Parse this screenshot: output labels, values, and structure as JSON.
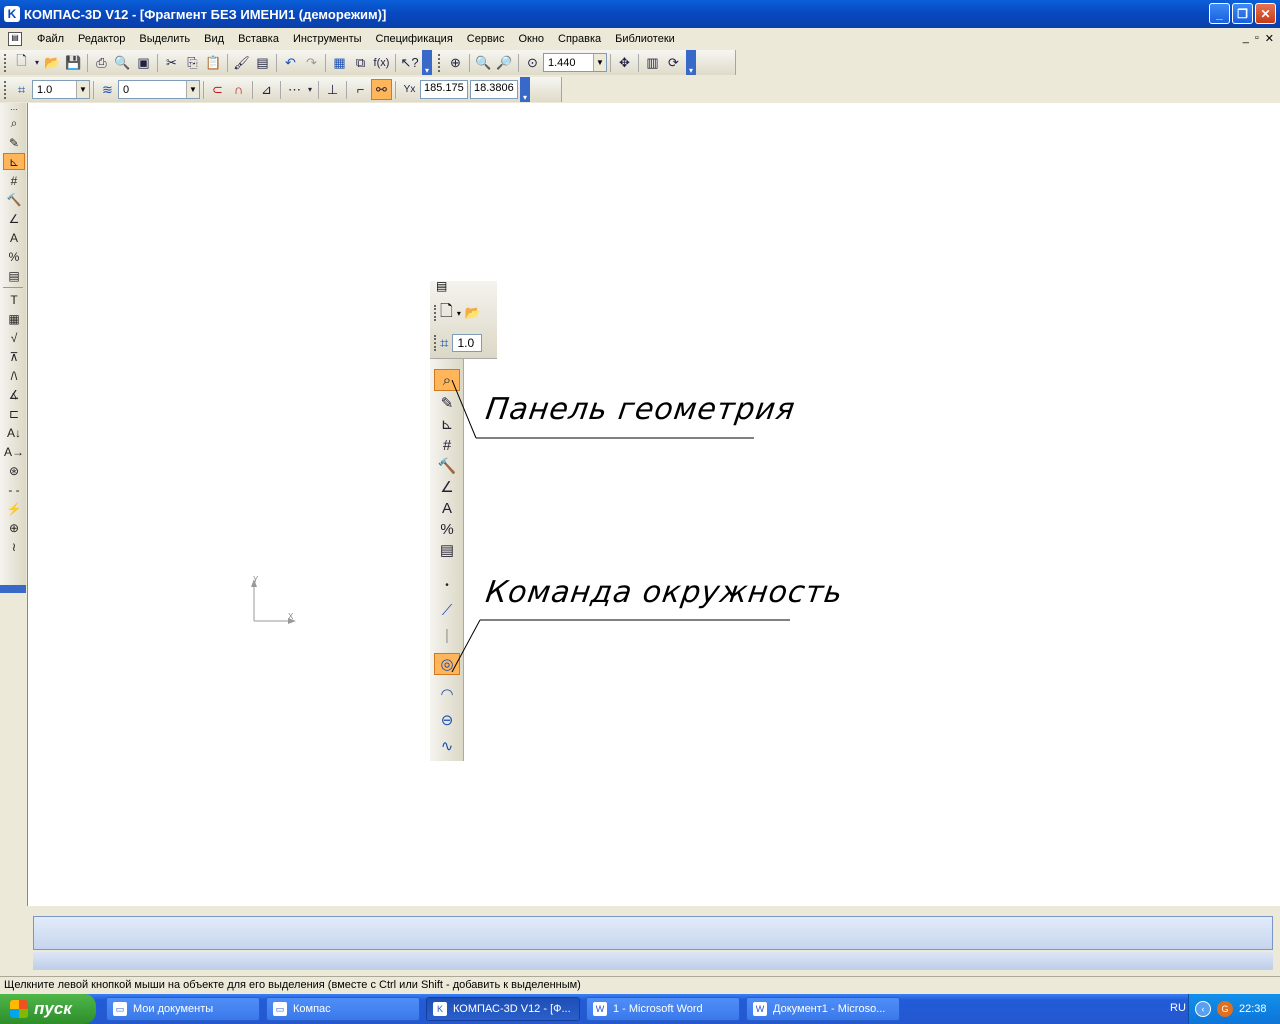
{
  "window": {
    "title": "КОМПАС-3D V12 - [Фрагмент БЕЗ ИМЕНИ1 (деморежим)]",
    "controls": [
      "_",
      "❐",
      "✕"
    ]
  },
  "menu": {
    "items": [
      "Файл",
      "Редактор",
      "Выделить",
      "Вид",
      "Вставка",
      "Инструменты",
      "Спецификация",
      "Сервис",
      "Окно",
      "Справка",
      "Библиотеки"
    ],
    "mdi_controls": [
      "_",
      "▫",
      "✕"
    ]
  },
  "toolbar1": {
    "zoom_value": "1.440"
  },
  "toolbar2": {
    "step_value": "1.0",
    "layer_value": "0",
    "coord_x": "185.175",
    "coord_y": "18.3806"
  },
  "canvas": {
    "axis_x": "X",
    "axis_y": "Y",
    "callouts": {
      "geometry_panel": "Панель геометрия",
      "circle_command": "Команда окружность"
    },
    "inset": {
      "step_value": "1.0"
    }
  },
  "status": {
    "text": "Щелкните левой кнопкой мыши на объекте для его выделения (вместе с Ctrl или Shift - добавить к выделенным)"
  },
  "taskbar": {
    "start_label": "пуск",
    "tasks": [
      "Мои документы",
      "Компас",
      "КОМПАС-3D V12 - [Ф...",
      "1 - Microsoft Word",
      "Документ1 - Microso..."
    ],
    "lang": "RU",
    "clock": "22:38"
  }
}
